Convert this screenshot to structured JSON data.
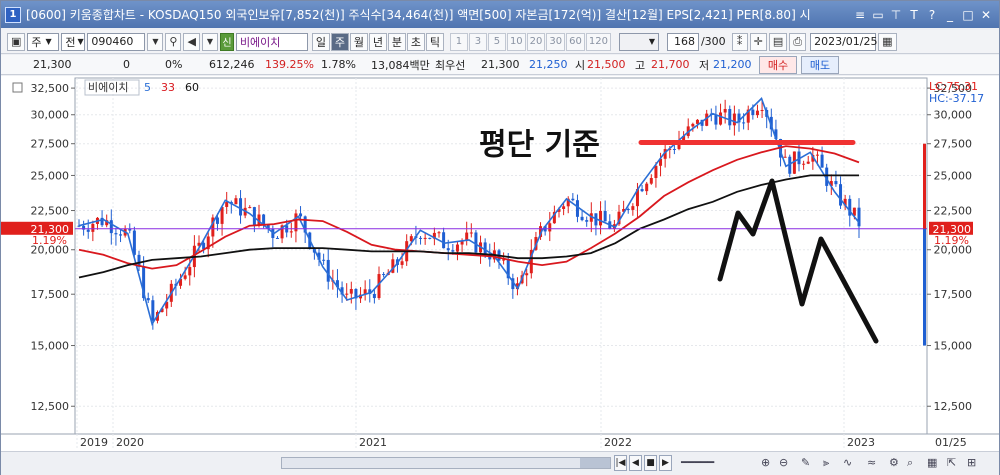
{
  "window": {
    "badge": "1",
    "title": "[0600] 키움종합차트 - KOSDAQ150 외국인보유[7,852(천)] 주식수[34,464(천)] 액면[500] 자본금[172(억)] 결산[12월] EPS[2,421] PER[8.80] 시"
  },
  "toolbar": {
    "period_type": "주",
    "adj_label": "전",
    "code": "090460",
    "stock_tag": "신",
    "stock_name": "비에이치",
    "periods": [
      "일",
      "주",
      "월",
      "년",
      "분",
      "초",
      "틱"
    ],
    "active_period": "주",
    "numbers": [
      "1",
      "3",
      "5",
      "10",
      "20",
      "30",
      "60",
      "120"
    ],
    "count": "168",
    "count_total": "/300",
    "date": "2023/01/25"
  },
  "pricebar": {
    "price": "21,300",
    "change": "0",
    "change_pct": "0%",
    "volume": "612,246",
    "vol_ratio": "139.25%",
    "turnover": "1.78%",
    "amount": "13,084백만",
    "best_label": "최우선",
    "best_ask": "21,300",
    "best_bid": "21,250",
    "open_label": "시",
    "open": "21,500",
    "high_label": "고",
    "high": "21,700",
    "low_label": "저",
    "low": "21,200",
    "buy_label": "매수",
    "sell_label": "매도"
  },
  "chart": {
    "legend_name": "비에이치",
    "ma": [
      {
        "period": "5",
        "color": "#2b6fd6"
      },
      {
        "period": "33",
        "color": "#d9181e"
      },
      {
        "period": "60",
        "color": "#111111"
      }
    ],
    "annotation": "평단 기준",
    "lc_label": "LC:75.31",
    "hc_label": "HC:-37.17",
    "current_price_label": "21,300",
    "change_label": "1.19%",
    "left_y_ticks": [
      "32,500",
      "30,000",
      "27,500",
      "25,000",
      "22,500",
      "20,000",
      "17,500",
      "15,000",
      "12,500"
    ],
    "right_y_ticks": [
      "32,500",
      "30,000",
      "27,500",
      "25,000",
      "22,500",
      "20,000",
      "17,500",
      "15,000",
      "12,500"
    ],
    "x_ticks": [
      "2019",
      "2020",
      "2021",
      "2022",
      "2023"
    ],
    "right_date": "01/25",
    "colors": {
      "up": "#e0201c",
      "down": "#1f5fd2",
      "current": "#8a2be2",
      "annot_line": "#f03232"
    }
  },
  "chart_data": {
    "type": "candlestick",
    "series": [
      {
        "name": "5",
        "values": [
          21500,
          21900,
          21000,
          16000,
          18000,
          20300,
          23200,
          22300,
          21000,
          22100,
          19000,
          17200,
          17600,
          19100,
          21200,
          20400,
          20600,
          19700,
          17800,
          21200,
          23300,
          22100,
          21400,
          24200,
          26700,
          28500,
          30100,
          29300,
          31500,
          25700,
          26800,
          23800,
          21700
        ]
      },
      {
        "name": "33",
        "values": [
          20000,
          19700,
          19200,
          18900,
          19100,
          19900,
          20800,
          21500,
          21600,
          21900,
          21800,
          21100,
          20300,
          20000,
          19900,
          19800,
          19700,
          19600,
          19300,
          19100,
          19300,
          20100,
          21000,
          22100,
          23500,
          24500,
          25400,
          26200,
          26800,
          27300,
          27100,
          26700,
          26000
        ]
      },
      {
        "name": "60",
        "values": [
          18400,
          18700,
          19100,
          19400,
          19500,
          19600,
          19800,
          20000,
          20100,
          20100,
          20100,
          20000,
          19900,
          19900,
          19900,
          19800,
          19800,
          19700,
          19500,
          19500,
          19600,
          19800,
          20400,
          21300,
          21900,
          22600,
          23100,
          23800,
          24300,
          24700,
          25000,
          25000,
          25000
        ]
      }
    ],
    "x": [
      "2019",
      "",
      "2020",
      "",
      "",
      "",
      "",
      "",
      "",
      "",
      "2021",
      "",
      "",
      "",
      "",
      "",
      "",
      "",
      "",
      "",
      "2022",
      "",
      "",
      "",
      "",
      "",
      "",
      "",
      "",
      "",
      "",
      "",
      "2023"
    ],
    "last_price": 21300,
    "annotation_level": 27600,
    "ylim": [
      11500,
      33500
    ],
    "scale": "log"
  }
}
